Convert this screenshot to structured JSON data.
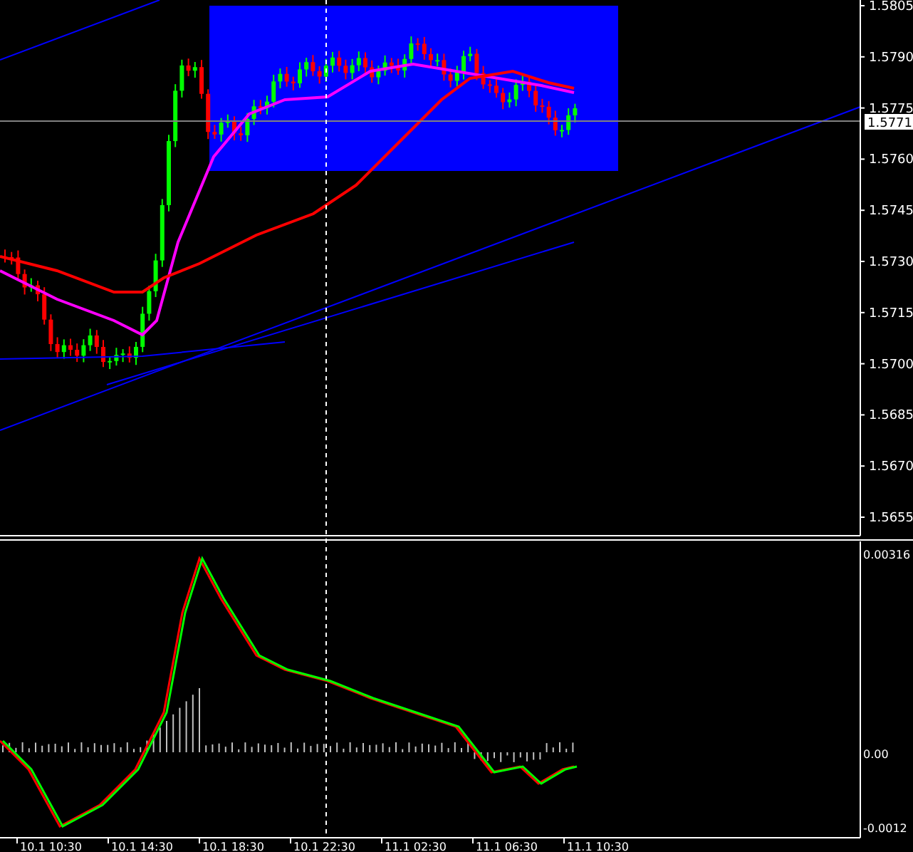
{
  "price_axis": {
    "labels": [
      "1.5805",
      "1.5790",
      "1.5775",
      "1.5760",
      "1.5745",
      "1.5730",
      "1.5715",
      "1.5700",
      "1.5685",
      "1.5670",
      "1.5655"
    ]
  },
  "current_price": "1.5771",
  "indicator_axis": {
    "labels": [
      "0.00316",
      "0.00",
      "-0.0012"
    ]
  },
  "time_axis": {
    "labels": [
      "10.1 10:30",
      "10.1 14:30",
      "10.1 18:30",
      "10.1 22:30",
      "11.1 02:30",
      "11.1 06:30",
      "11.1 10:30"
    ]
  }
}
